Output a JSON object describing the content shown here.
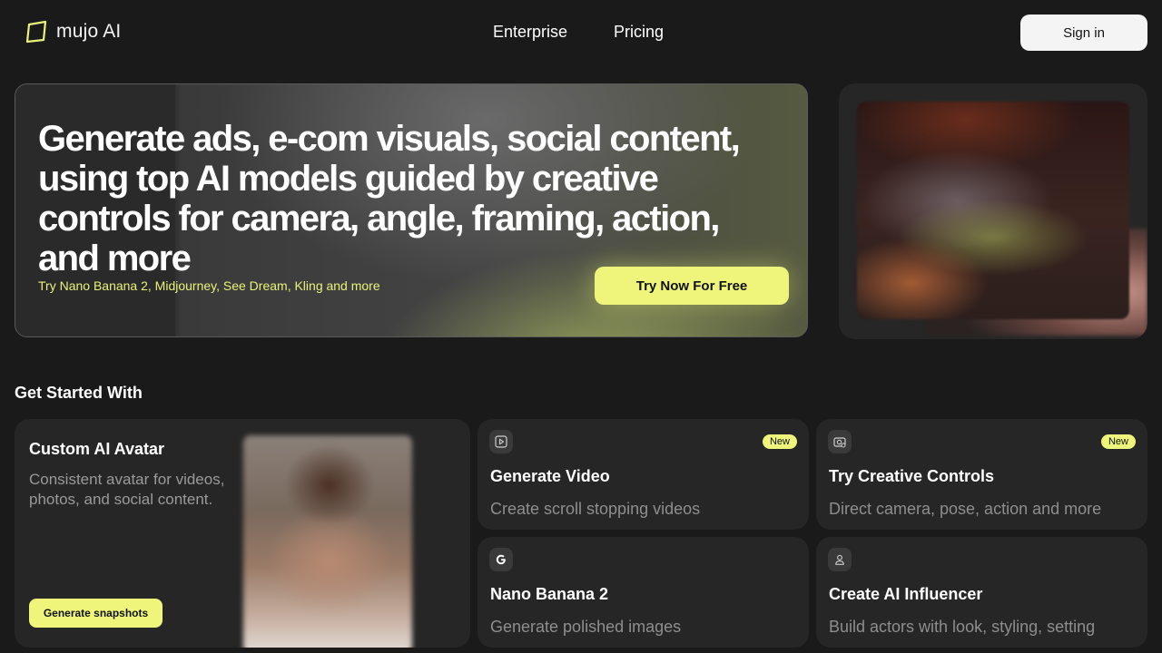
{
  "brand": {
    "name": "mujo AI",
    "accent": "#eef57a"
  },
  "nav": {
    "links": [
      "Enterprise",
      "Pricing"
    ],
    "signin_label": "Sign in"
  },
  "hero": {
    "title": "Generate ads, e-com visuals, social content, using top AI models guided by creative controls for camera, angle, framing, action, and more",
    "subtitle": "Try Nano Banana 2, Midjourney, See Dream, Kling and more",
    "cta_label": "Try Now For Free"
  },
  "section": {
    "title": "Get Started With"
  },
  "avatar_card": {
    "title": "Custom AI Avatar",
    "description": "Consistent avatar for videos, photos, and social content.",
    "button_label": "Generate snapshots"
  },
  "tiles": [
    {
      "icon": "video-play-icon",
      "badge": "New",
      "title": "Generate Video",
      "description": "Create scroll stopping videos"
    },
    {
      "icon": "camera-control-icon",
      "badge": "New",
      "title": "Try Creative Controls",
      "description": "Direct camera, pose, action and more"
    },
    {
      "icon": "google-g-icon",
      "badge": "",
      "title": "Nano Banana 2",
      "description": "Generate polished images"
    },
    {
      "icon": "user-icon",
      "badge": "",
      "title": "Create AI Influencer",
      "description": "Build actors with look, styling, setting"
    }
  ]
}
